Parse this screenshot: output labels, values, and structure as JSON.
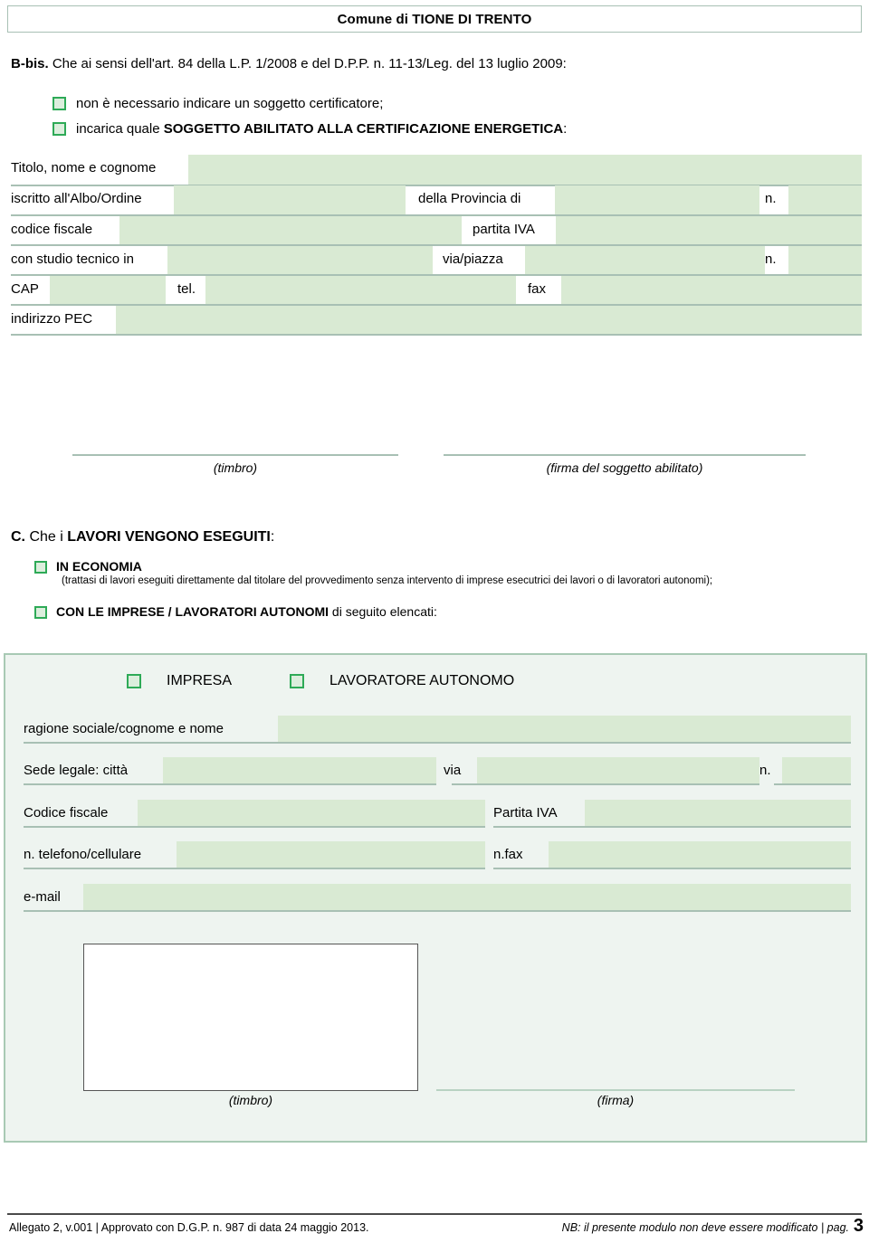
{
  "header": {
    "comune_title": "Comune di TIONE DI TRENTO"
  },
  "section_bbis": {
    "marker": "B-bis.",
    "heading": " Che ai sensi dell'art. 84 della L.P. 1/2008 e del D.P.P. n. 11-13/Leg. del 13 luglio 2009:",
    "options": [
      {
        "text_plain": "non è necessario indicare un soggetto certificatore;"
      },
      {
        "text_prefix": "incarica quale ",
        "text_bold": "SOGGETTO ABILITATO ALLA CERTIFICAZIONE ENERGETICA",
        "text_suffix": ":"
      }
    ],
    "fields": {
      "titolo_nome_cognome": {
        "label": "Titolo, nome e cognome",
        "value": ""
      },
      "iscritto_albo": {
        "label": "iscritto all'Albo/Ordine",
        "value": ""
      },
      "della_provincia_di": {
        "label": "della Provincia di",
        "value": ""
      },
      "numero_albo": {
        "label": "n.",
        "value": ""
      },
      "codice_fiscale": {
        "label": "codice fiscale",
        "value": ""
      },
      "partita_iva": {
        "label": "partita IVA",
        "value": ""
      },
      "con_studio_tecnico_in": {
        "label": "con studio tecnico in",
        "value": ""
      },
      "via_piazza": {
        "label": "via/piazza",
        "value": ""
      },
      "numero_civico": {
        "label": "n.",
        "value": ""
      },
      "cap": {
        "label": "CAP",
        "value": ""
      },
      "tel": {
        "label": "tel.",
        "value": ""
      },
      "fax": {
        "label": "fax",
        "value": ""
      },
      "indirizzo_pec": {
        "label": "indirizzo PEC",
        "value": ""
      }
    },
    "signatures": {
      "timbro": "(timbro)",
      "firma": "(firma del soggetto abilitato)"
    }
  },
  "section_c": {
    "marker": "C.",
    "heading_prefix": " Che i ",
    "heading_bold": "LAVORI VENGONO ESEGUITI",
    "heading_suffix": ":",
    "option_economia": "IN ECONOMIA",
    "option_economia_note": "(trattasi di lavori eseguiti direttamente dal titolare del provvedimento senza intervento di imprese esecutrici dei lavori o di lavoratori autonomi);",
    "option_imprese_bold": "CON LE IMPRESE / LAVORATORI AUTONOMI",
    "option_imprese_rest": "  di seguito elencati:"
  },
  "panel": {
    "type_options": [
      {
        "label": "IMPRESA"
      },
      {
        "label": "LAVORATORE AUTONOMO"
      }
    ],
    "fields": {
      "ragione_sociale": {
        "label": "ragione sociale/cognome e nome",
        "value": ""
      },
      "sede_legale_citta": {
        "label": "Sede legale: città",
        "value": ""
      },
      "via": {
        "label": "via",
        "value": ""
      },
      "numero_civico": {
        "label": "n.",
        "value": ""
      },
      "codice_fiscale": {
        "label": "Codice fiscale",
        "value": ""
      },
      "partita_iva": {
        "label": "Partita IVA",
        "value": ""
      },
      "telefono_cellulare": {
        "label": "n. telefono/cellulare",
        "value": ""
      },
      "fax": {
        "label": "n.fax",
        "value": ""
      },
      "email": {
        "label": "e-mail",
        "value": ""
      }
    },
    "signatures": {
      "timbro": "(timbro)",
      "firma": "(firma)"
    }
  },
  "footer": {
    "left": "Allegato 2, v.001 | Approvato con D.G.P. n. 987 di data 24 maggio 2013.",
    "right": "NB: il presente modulo non deve essere modificato | pag.",
    "page_number": "3"
  },
  "colors": {
    "field_fill": "#d9ead3",
    "rule": "#a8c0b4",
    "checkbox_border": "#2eaa57",
    "checkbox_fill": "#dceedd",
    "panel_bg": "#eef4f0",
    "panel_border": "#a8c9b4"
  }
}
